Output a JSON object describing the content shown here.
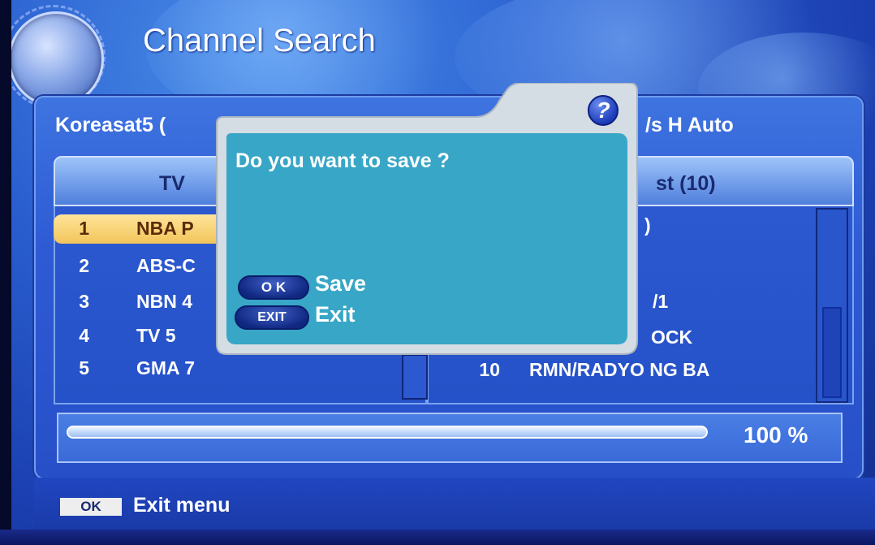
{
  "header": {
    "title": "Channel Search"
  },
  "info": {
    "satellite_left": "Koreasat5 (",
    "satellite_right": "/s H Auto"
  },
  "columns": {
    "left_header": "TV",
    "right_header": "st (10)"
  },
  "tv_list": [
    {
      "num": "1",
      "name": "NBA P"
    },
    {
      "num": "2",
      "name": "ABS-C"
    },
    {
      "num": "3",
      "name": "NBN 4"
    },
    {
      "num": "4",
      "name": "TV 5"
    },
    {
      "num": "5",
      "name": "GMA 7"
    }
  ],
  "radio_list": [
    {
      "num": "",
      "name": ")"
    },
    {
      "num": "",
      "name": ""
    },
    {
      "num": "",
      "name": "/1"
    },
    {
      "num": "",
      "name": "OCK"
    },
    {
      "num": "10",
      "name": "RMN/RADYO NG BA"
    }
  ],
  "progress": {
    "percent": 100,
    "label": "100 %"
  },
  "footer": {
    "key_label": "OK",
    "text": "Exit menu"
  },
  "dialog": {
    "message": "Do you want to save ?",
    "help_glyph": "?",
    "ok_key": "O K",
    "ok_label": "Save",
    "exit_key": "EXIT",
    "exit_label": "Exit"
  },
  "colors": {
    "background": "#2a5fd0",
    "selected_row": "#f2c45a",
    "dialog_fill": "#3aa8c8",
    "dialog_border": "#cfd8e0"
  },
  "icons": {
    "help": "question-mark-icon",
    "logo": "globe-logo-icon"
  }
}
